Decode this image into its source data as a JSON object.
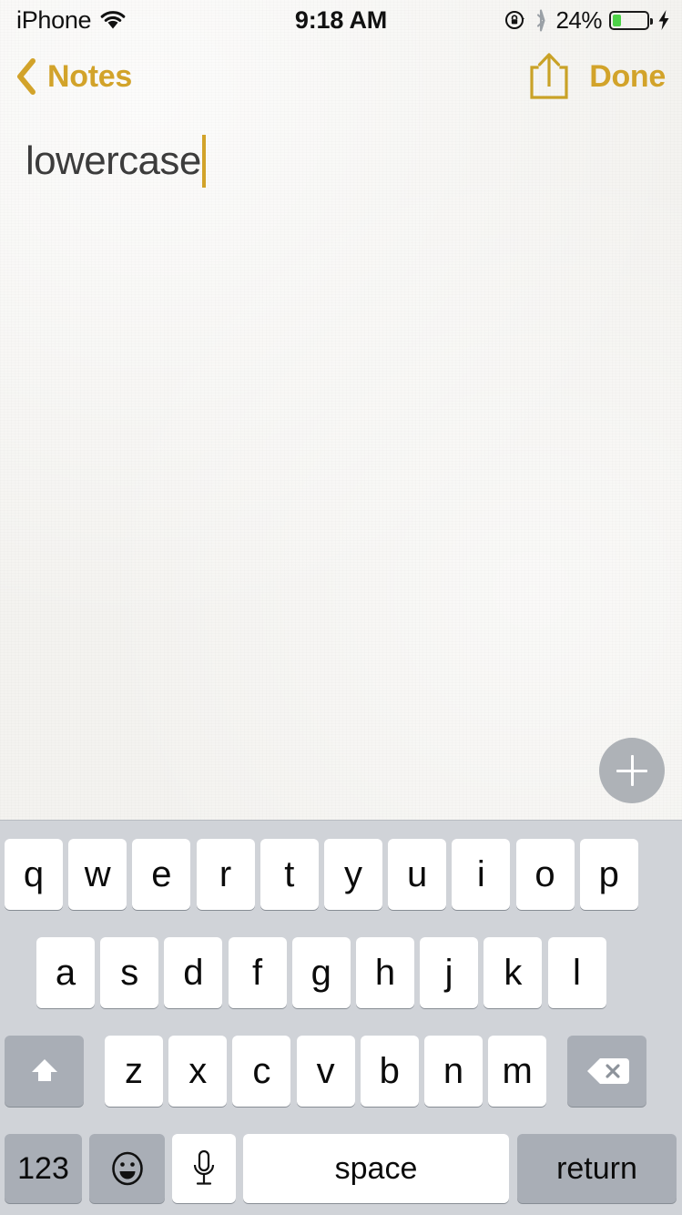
{
  "status_bar": {
    "carrier": "iPhone",
    "wifi_icon": "wifi-icon",
    "time": "9:18 AM",
    "rotation_lock_icon": "rotation-lock-icon",
    "bluetooth_icon": "bluetooth-icon",
    "battery_percent": "24%",
    "battery_level": 24,
    "battery_color": "#4cd247",
    "charging_icon": "charging-bolt-icon"
  },
  "nav_bar": {
    "back_label": "Notes",
    "back_icon": "chevron-left-icon",
    "share_icon": "share-icon",
    "done_label": "Done",
    "accent_color": "#d2a32a"
  },
  "note": {
    "text": "lowercase",
    "caret_color": "#d2a32a",
    "text_color": "#3c3c3c"
  },
  "add_button": {
    "icon": "plus-icon",
    "color": "#aeb2b7"
  },
  "keyboard": {
    "row1": [
      "q",
      "w",
      "e",
      "r",
      "t",
      "y",
      "u",
      "i",
      "o",
      "p"
    ],
    "row2": [
      "a",
      "s",
      "d",
      "f",
      "g",
      "h",
      "j",
      "k",
      "l"
    ],
    "row3_letters": [
      "z",
      "x",
      "c",
      "v",
      "b",
      "n",
      "m"
    ],
    "shift_icon": "shift-up-arrow-icon",
    "backspace_icon": "backspace-delete-icon",
    "numeric_label": "123",
    "emoji_icon": "emoji-smiley-icon",
    "dictation_icon": "microphone-icon",
    "space_label": "space",
    "return_label": "return",
    "key_color": "#ffffff",
    "modifier_key_color": "#a9aeb6",
    "background_color": "#d0d3d8"
  }
}
